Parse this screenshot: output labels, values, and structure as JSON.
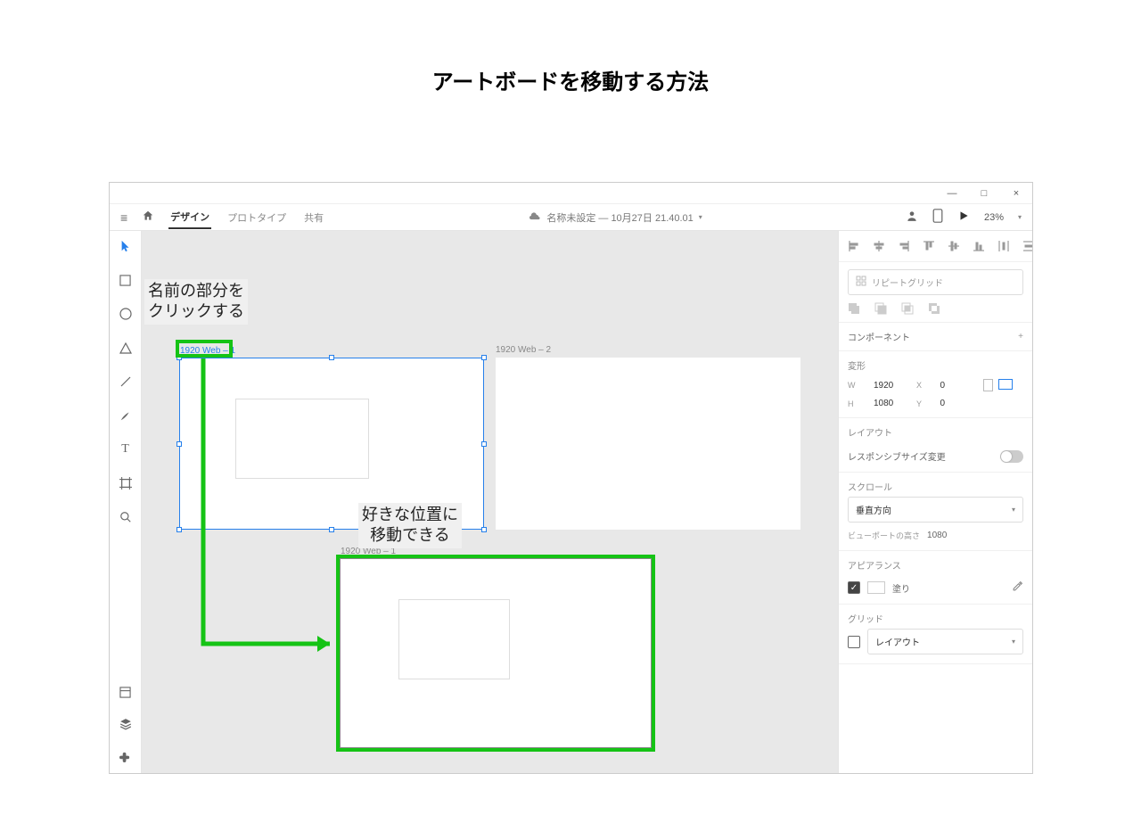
{
  "page": {
    "title": "アートボードを移動する方法"
  },
  "titlebar": {
    "min": "—",
    "max": "□",
    "close": "×"
  },
  "topbar": {
    "menu_icon": "≡",
    "tabs": {
      "design": "デザイン",
      "prototype": "プロトタイプ",
      "share": "共有"
    },
    "doc_title": "名称未設定 — 10月27日 21.40.01",
    "zoom": "23%"
  },
  "tools": {
    "select": "▲",
    "rect": "□",
    "ellipse": "○",
    "polygon": "△",
    "line": "/",
    "pen": "✎",
    "text": "T",
    "artboard": "▭",
    "zoom_tool": "🔍"
  },
  "canvas": {
    "ab1_label": "1920 Web – 1",
    "ab2_label": "1920 Web – 2",
    "ab3_label": "1920 Web – 1",
    "callout1": "名前の部分を\nクリックする",
    "callout2": "好きな位置に\n移動できる"
  },
  "panel": {
    "repeat_grid": "リピートグリッド",
    "component_label": "コンポーネント",
    "transform_label": "変形",
    "w_label": "W",
    "w_value": "1920",
    "h_label": "H",
    "h_value": "1080",
    "x_label": "X",
    "x_value": "0",
    "y_label": "Y",
    "y_value": "0",
    "layout_label": "レイアウト",
    "responsive_label": "レスポンシブサイズ変更",
    "scroll_label": "スクロール",
    "scroll_value": "垂直方向",
    "viewport_label": "ビューポートの高さ",
    "viewport_value": "1080",
    "appearance_label": "アピアランス",
    "fill_label": "塗り",
    "grid_label": "グリッド",
    "grid_value": "レイアウト"
  }
}
